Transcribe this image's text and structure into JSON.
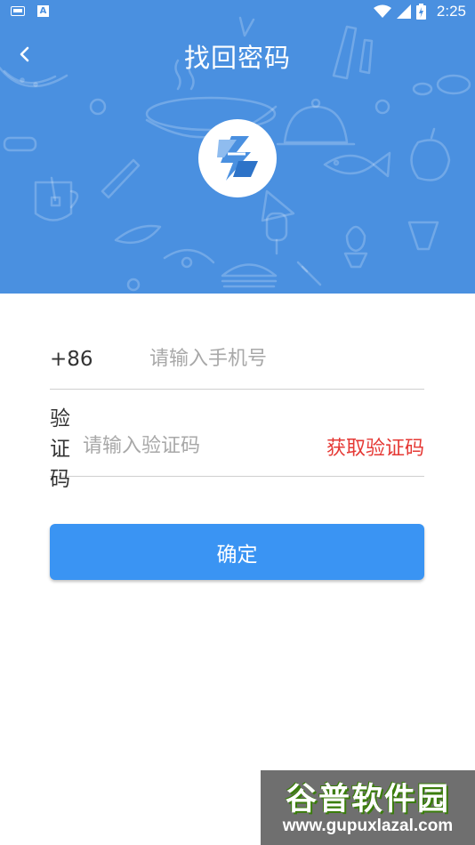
{
  "status_bar": {
    "time": "2:25",
    "icons": [
      "keyboard-icon",
      "a-icon",
      "wifi-icon",
      "signal-icon",
      "battery-charging-icon"
    ]
  },
  "header": {
    "title": "找回密码",
    "back_icon": "chevron-left-icon",
    "background_color": "#4a90e0",
    "logo_icon": "app-logo-icon"
  },
  "form": {
    "phone": {
      "prefix": "+86",
      "placeholder": "请输入手机号",
      "value": ""
    },
    "code": {
      "label": "验证码",
      "placeholder": "请输入验证码",
      "value": "",
      "get_code_label": "获取验证码",
      "get_code_color": "#e53935"
    }
  },
  "confirm": {
    "label": "确定",
    "color": "#3a94f3"
  },
  "watermark": {
    "title": "谷普软件园",
    "url": "www.gupuxlazal.com"
  }
}
